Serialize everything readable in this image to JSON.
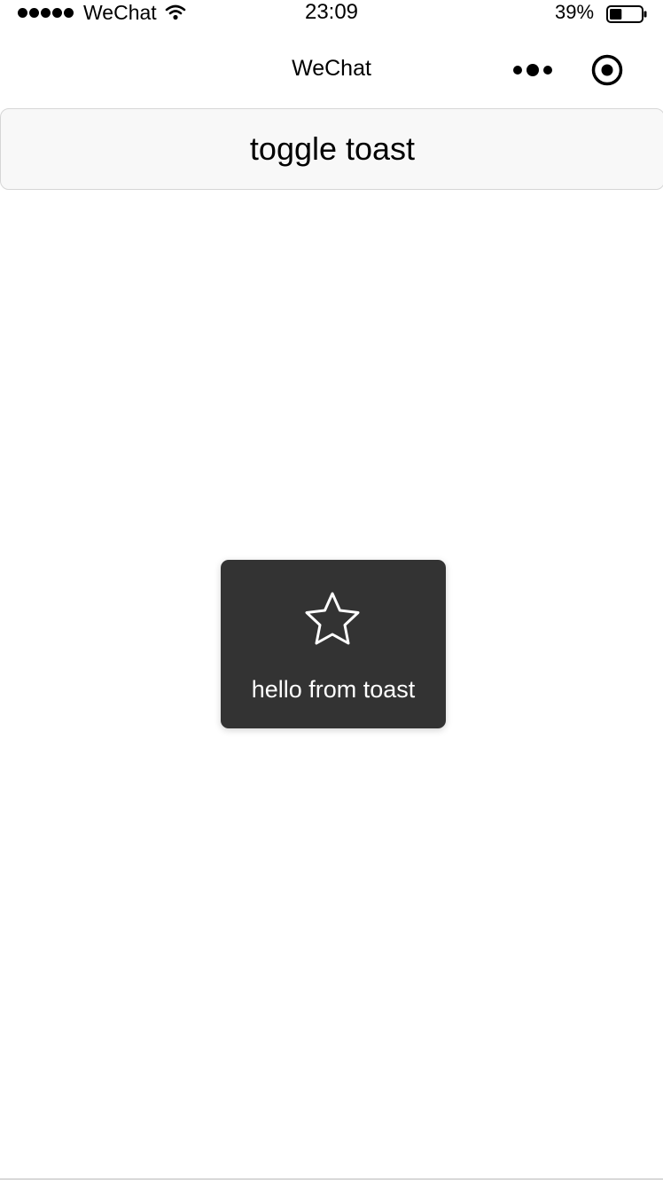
{
  "status_bar": {
    "carrier": "WeChat",
    "time": "23:09",
    "battery_percent": "39%",
    "battery_level": 0.39,
    "signal_icon": "signal-dots-icon",
    "wifi_icon": "wifi-icon",
    "battery_icon": "battery-icon"
  },
  "nav_bar": {
    "title": "WeChat",
    "more_icon": "more-dots-icon",
    "close_icon": "target-close-icon"
  },
  "main": {
    "toggle_button_label": "toggle toast"
  },
  "toast": {
    "icon": "star-icon",
    "message": "hello from toast",
    "background": "#333333",
    "text_color": "#ffffff"
  }
}
